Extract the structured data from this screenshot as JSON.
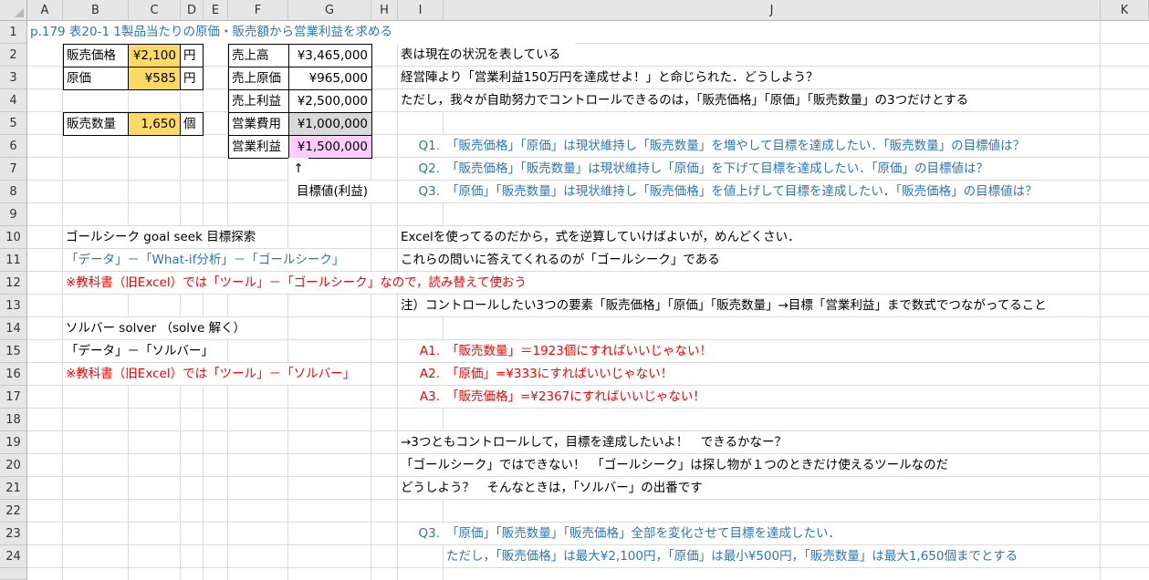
{
  "columns": [
    "A",
    "B",
    "C",
    "D",
    "E",
    "F",
    "G",
    "H",
    "I",
    "J",
    "K"
  ],
  "rows": [
    "1",
    "2",
    "3",
    "4",
    "5",
    "6",
    "7",
    "8",
    "9",
    "10",
    "11",
    "12",
    "13",
    "14",
    "15",
    "16",
    "17",
    "18",
    "19",
    "20",
    "21",
    "22",
    "23",
    "24"
  ],
  "title": "p.179 表20-1 1製品当たりの原価・販売額から営業利益を求める",
  "inputs": {
    "price_label": "販売価格",
    "price_value": "¥2,100",
    "price_unit": "円",
    "cost_label": "原価",
    "cost_value": "¥585",
    "cost_unit": "円",
    "qty_label": "販売数量",
    "qty_value": "1,650",
    "qty_unit": "個"
  },
  "pl": {
    "sales_label": "売上高",
    "sales_value": "¥3,465,000",
    "cogs_label": "売上原価",
    "cogs_value": "¥965,000",
    "gross_label": "売上利益",
    "gross_value": "¥2,500,000",
    "opex_label": "営業費用",
    "opex_value": "¥1,000,000",
    "op_label": "営業利益",
    "op_value": "¥1,500,000",
    "arrow": "↑",
    "target_label": "目標値(利益)"
  },
  "text_j": {
    "r2": "表は現在の状況を表している",
    "r3": "経営陣より「営業利益150万円を達成せよ！」と命じられた．どうしよう？",
    "r4": "ただし，我々が自助努力でコントロールできるのは，「販売価格」「原価」「販売数量」の3つだけとする",
    "r6_label": "Q1.",
    "r6": "「販売価格」「原価」は現状維持し「販売数量」を増やして目標を達成したい．「販売数量」の目標値は？",
    "r7_label": "Q2.",
    "r7": "「販売価格」「販売数量」は現状維持し「原価」を下げて目標を達成したい．「原価」の目標値は？",
    "r8_label": "Q3.",
    "r8": "「原価」「販売数量」は現状維持し「販売価格」を値上げして目標を達成したい．「販売価格」の目標値は？",
    "r10": "Excelを使ってるのだから，式を逆算していけばよいが，めんどくさい．",
    "r11": "これらの問いに答えてくれるのが「ゴールシーク」である",
    "r13": "注）コントロールしたい3つの要素「販売価格」「原価」「販売数量」→目標「営業利益」まで数式でつながってること",
    "r15_label": "A1.",
    "r15": "「販売数量」＝1923個にすればいいじゃない！",
    "r16_label": "A2.",
    "r16": "「原価」=¥333にすればいいじゃない！",
    "r17_label": "A3.",
    "r17": "「販売価格」=¥2367にすればいいじゃない！",
    "r19": "→3つともコントロールして，目標を達成したいよ！　できるかなー？",
    "r20": "「ゴールシーク」ではできない！　「ゴールシーク」は探し物が１つのときだけ使えるツールなのだ",
    "r21": "どうしよう？　そんなときは，「ソルバー」の出番です",
    "r23_label": "Q3.",
    "r23": "「原価」「販売数量」「販売価格」全部を変化させて目標を達成したい．",
    "r24": "ただし，「販売価格」は最大¥2,100円，「原価」は最小¥500円，「販売数量」は最大1,650個までとする"
  },
  "text_b": {
    "r10": "ゴールシーク goal seek 目標探索",
    "r11": "「データ」－「What-if分析」－「ゴールシーク」",
    "r12": "※教科書（旧Excel）では「ツール」－「ゴールシーク」なので，読み替えて使おう",
    "r14": "ソルバー solver （solve 解く）",
    "r15": "「データ」－「ソルバー」",
    "r16": "※教科書（旧Excel）では「ツール」－「ソルバー」"
  },
  "colors": {
    "yellow": "#ffd966",
    "pink": "#ffccff",
    "gray": "#d9d9d9",
    "blue": "#2e75b6",
    "red": "#ff0000"
  }
}
